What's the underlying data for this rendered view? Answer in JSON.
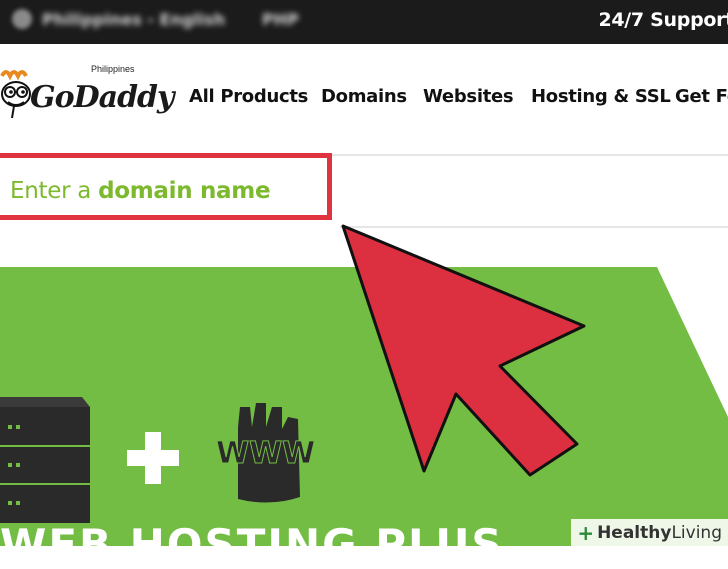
{
  "topbar": {
    "locale": "Philippines - English",
    "currency": "PHP",
    "support": "24/7 Support"
  },
  "brand": {
    "name": "GoDaddy",
    "country": "Philippines"
  },
  "nav": [
    "All Products",
    "Domains",
    "Websites",
    "Hosting & SSL",
    "Get Fo"
  ],
  "search": {
    "placeholder_prefix": "Enter a ",
    "placeholder_bold": "domain name"
  },
  "banner": {
    "headline": "WEB HOSTING PLUS",
    "color": "#74bd44"
  },
  "watermark": {
    "bold": "Healthy",
    "rest": " Living"
  },
  "colors": {
    "topbar": "#1b1b1b",
    "highlight": "#df3340",
    "green_text": "#7cb92c",
    "arrow": "#dc3040"
  }
}
